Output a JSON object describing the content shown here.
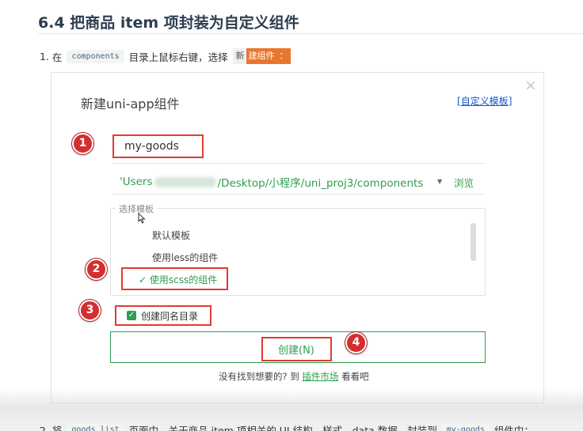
{
  "heading": "6.4 把商品 item 项封装为自定义组件",
  "step1": {
    "num": "1.",
    "text_a": "在",
    "code": "components",
    "text_b": "目录上鼠标右键，选择",
    "menu_grey": "新",
    "menu_orange": "建组件",
    "menu_tail": "："
  },
  "dialog": {
    "title": "新建uni-app组件",
    "template_link": {
      "open": "[",
      "label": "自定义模板",
      "close": "]"
    },
    "close": "×",
    "name_value": "my-goods",
    "path": {
      "prefix": "'Users",
      "suffix": "/Desktop/小程序/uni_proj3/components",
      "dropdown": "▼",
      "browse": "浏览"
    },
    "template_legend": "选择模板",
    "templates": [
      {
        "label": "默认模板",
        "selected": false
      },
      {
        "label": "使用less的组件",
        "selected": false
      },
      {
        "label": "使用scss的组件",
        "selected": true
      }
    ],
    "check_mark": "✓",
    "same_dir": {
      "checked": true,
      "label": "创建同名目录",
      "mark": "✓"
    },
    "create_button": "创建(N)",
    "market": {
      "before": "没有找到想要的? 到",
      "link": "插件市场",
      "after": "看看吧"
    }
  },
  "badges": [
    "1",
    "2",
    "3",
    "4"
  ],
  "step2": {
    "text": "2. 将",
    "code1": "goods_list",
    "mid": "页面中，关于商品 item 项相关的 UI 结构、样式、data 数据，封装到",
    "code2": "my-goods",
    "end": "组件中："
  },
  "colors": {
    "accent_green": "#2e9e4e",
    "highlight_red": "#e53935",
    "menu_orange": "#e8772e",
    "link_blue": "#1a55c9"
  }
}
